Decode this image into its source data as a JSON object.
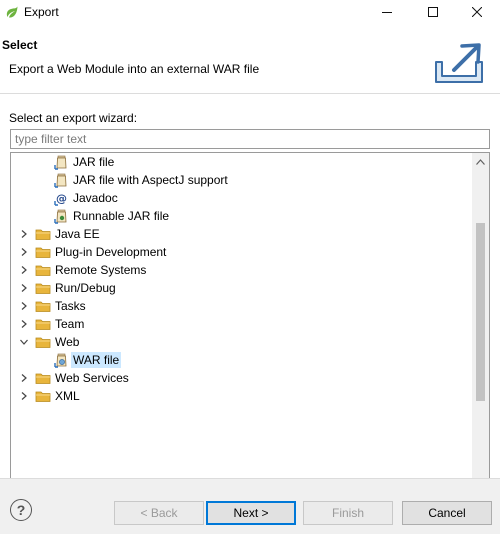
{
  "window": {
    "title": "Export",
    "icon": "eclipse-spring-icon",
    "accent": "#6db33f"
  },
  "header": {
    "title": "Select",
    "description": "Export a Web Module into an external WAR file",
    "icon": "export-icon"
  },
  "wizard": {
    "label": "Select an export wizard:",
    "filter_placeholder": "type filter text",
    "filter_value": ""
  },
  "tree": {
    "items": [
      {
        "label": "JAR file",
        "type": "jar",
        "level": 2,
        "expanded": null,
        "selected": false
      },
      {
        "label": "JAR file with AspectJ support",
        "type": "jar",
        "level": 2,
        "expanded": null,
        "selected": false
      },
      {
        "label": "Javadoc",
        "type": "javadoc",
        "level": 2,
        "expanded": null,
        "selected": false
      },
      {
        "label": "Runnable JAR file",
        "type": "jar-run",
        "level": 2,
        "expanded": null,
        "selected": false
      },
      {
        "label": "Java EE",
        "type": "folder",
        "level": 1,
        "expanded": false,
        "selected": false
      },
      {
        "label": "Plug-in Development",
        "type": "folder",
        "level": 1,
        "expanded": false,
        "selected": false
      },
      {
        "label": "Remote Systems",
        "type": "folder",
        "level": 1,
        "expanded": false,
        "selected": false
      },
      {
        "label": "Run/Debug",
        "type": "folder",
        "level": 1,
        "expanded": false,
        "selected": false
      },
      {
        "label": "Tasks",
        "type": "folder",
        "level": 1,
        "expanded": false,
        "selected": false
      },
      {
        "label": "Team",
        "type": "folder",
        "level": 1,
        "expanded": false,
        "selected": false
      },
      {
        "label": "Web",
        "type": "folder",
        "level": 1,
        "expanded": true,
        "selected": false
      },
      {
        "label": "WAR file",
        "type": "war",
        "level": 2,
        "expanded": null,
        "selected": true
      },
      {
        "label": "Web Services",
        "type": "folder",
        "level": 1,
        "expanded": false,
        "selected": false
      },
      {
        "label": "XML",
        "type": "folder",
        "level": 1,
        "expanded": false,
        "selected": false
      }
    ],
    "selection_color": "#cce8ff",
    "folder_color": "#e8b53c"
  },
  "buttons": {
    "help": "?",
    "back": "< Back",
    "next": "Next >",
    "finish": "Finish",
    "cancel": "Cancel"
  }
}
